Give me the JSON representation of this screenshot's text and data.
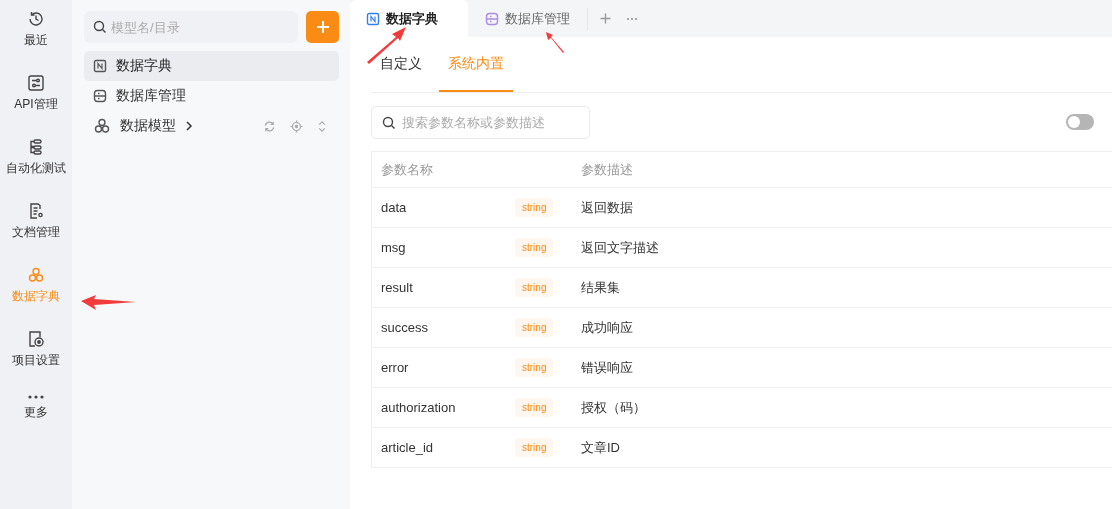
{
  "nav": [
    {
      "label": "最近",
      "kind": "history",
      "selected": false
    },
    {
      "label": "API管理",
      "kind": "sliders",
      "selected": false
    },
    {
      "label": "自动化测试",
      "kind": "flow",
      "selected": false
    },
    {
      "label": "文档管理",
      "kind": "doc",
      "selected": false
    },
    {
      "label": "数据字典",
      "kind": "model",
      "selected": true
    },
    {
      "label": "项目设置",
      "kind": "settings",
      "selected": false
    },
    {
      "label": "更多",
      "kind": "more",
      "selected": false
    }
  ],
  "sidebar": {
    "search": {
      "placeholder": "模型名/目录"
    },
    "items": [
      {
        "label": "数据字典",
        "kind": "dict",
        "selected": true,
        "expandable": false
      },
      {
        "label": "数据库管理",
        "kind": "db",
        "selected": false,
        "expandable": false
      },
      {
        "label": "数据模型",
        "kind": "model",
        "selected": false,
        "expandable": true
      }
    ]
  },
  "tabs": [
    {
      "label": "数据字典",
      "kind": "dict",
      "selected": true
    },
    {
      "label": "数据库管理",
      "kind": "db",
      "selected": false
    }
  ],
  "sub_tabs": [
    {
      "label": "自定义",
      "selected": false
    },
    {
      "label": "系统内置",
      "selected": true
    }
  ],
  "search": {
    "placeholder": "搜索参数名称或参数描述"
  },
  "toggle": {
    "on": false
  },
  "table": {
    "columns": [
      "参数名称",
      "参数描述"
    ],
    "rows": [
      {
        "name": "data",
        "type": "string",
        "description": "返回数据"
      },
      {
        "name": "msg",
        "type": "string",
        "description": "返回文字描述"
      },
      {
        "name": "result",
        "type": "string",
        "description": "结果集"
      },
      {
        "name": "success",
        "type": "string",
        "description": "成功响应"
      },
      {
        "name": "error",
        "type": "string",
        "description": "错误响应"
      },
      {
        "name": "authorization",
        "type": "string",
        "description": "授权（码）"
      },
      {
        "name": "article_id",
        "type": "string",
        "description": "文章ID"
      }
    ]
  }
}
